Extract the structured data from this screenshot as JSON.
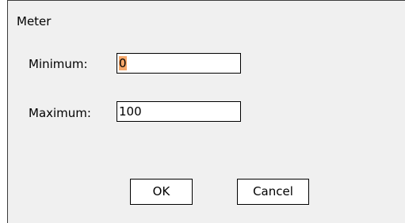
{
  "dialog": {
    "title": "Meter",
    "minimum": {
      "label": "Minimum:",
      "value": "0"
    },
    "maximum": {
      "label": "Maximum:",
      "value": "100"
    },
    "ok_label": "OK",
    "cancel_label": "Cancel"
  },
  "colors": {
    "dialog_background": "#f0f0f0",
    "selection_highlight": "#f5a76a",
    "border": "#000000"
  }
}
